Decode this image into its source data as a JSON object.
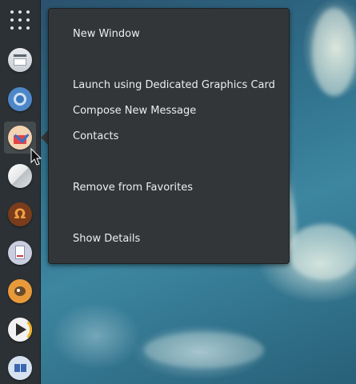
{
  "desktop": {
    "wallpaper": "daisy-flower-wallpaper"
  },
  "dock": {
    "items": [
      {
        "icon": "show-applications-icon"
      },
      {
        "icon": "files-app-icon"
      },
      {
        "icon": "chromium-browser-icon"
      },
      {
        "icon": "mail-app-icon",
        "active": true
      },
      {
        "icon": "disk-app-icon"
      },
      {
        "icon": "omega-app-icon"
      },
      {
        "icon": "document-viewer-icon"
      },
      {
        "icon": "gimp-app-icon"
      },
      {
        "icon": "media-player-icon"
      },
      {
        "icon": "remote-desktop-icon"
      }
    ]
  },
  "context_menu": {
    "new_window": "New Window",
    "launch_dedicated_gpu": "Launch using Dedicated Graphics Card",
    "compose_new_message": "Compose New Message",
    "contacts": "Contacts",
    "remove_from_favorites": "Remove from Favorites",
    "show_details": "Show Details"
  },
  "colors": {
    "dock_bg": "#2c3135",
    "menu_bg": "#333638",
    "menu_text": "#eceeef"
  }
}
